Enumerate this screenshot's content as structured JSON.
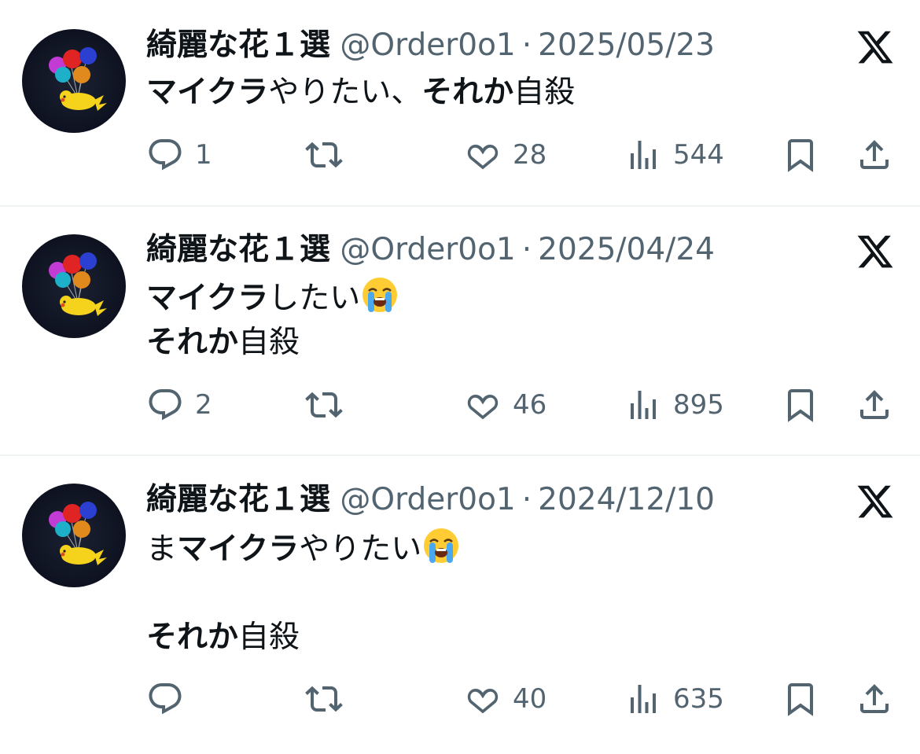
{
  "tweets": [
    {
      "name": "綺麗な花１選",
      "handle": "@Order0o1",
      "separator": "·",
      "date": "2025/05/23",
      "lines": [
        [
          {
            "text": "マイクラ",
            "bold": true
          },
          {
            "text": "やりたい、",
            "bold": false
          },
          {
            "text": "それか",
            "bold": true
          },
          {
            "text": "自殺",
            "bold": false
          }
        ]
      ],
      "emoji": "",
      "replies": "1",
      "reposts": "",
      "likes": "28",
      "views": "544"
    },
    {
      "name": "綺麗な花１選",
      "handle": "@Order0o1",
      "separator": "·",
      "date": "2025/04/24",
      "lines": [
        [
          {
            "text": "マイクラ",
            "bold": true
          },
          {
            "text": "したい",
            "bold": false
          }
        ],
        [
          {
            "text": "それか",
            "bold": true
          },
          {
            "text": "自殺",
            "bold": false
          }
        ]
      ],
      "emoji": "loudly-crying-face-emoji",
      "replies": "2",
      "reposts": "",
      "likes": "46",
      "views": "895"
    },
    {
      "name": "綺麗な花１選",
      "handle": "@Order0o1",
      "separator": "·",
      "date": "2024/12/10",
      "lines": [
        [
          {
            "text": "ま",
            "bold": false
          },
          {
            "text": "マイクラ",
            "bold": true
          },
          {
            "text": "やりたい",
            "bold": false
          }
        ],
        [],
        [
          {
            "text": "それか",
            "bold": true
          },
          {
            "text": "自殺",
            "bold": false
          }
        ]
      ],
      "emoji": "loudly-crying-face-emoji",
      "replies": "",
      "reposts": "",
      "likes": "40",
      "views": "635"
    }
  ],
  "icons": {
    "reply": "reply-icon",
    "repost": "repost-icon",
    "like": "heart-icon",
    "views": "views-icon",
    "bookmark": "bookmark-icon",
    "share": "share-icon",
    "brand": "x-logo-icon"
  },
  "colors": {
    "text": "#0f1419",
    "secondary": "#536471",
    "separator": "#eff3f4"
  }
}
